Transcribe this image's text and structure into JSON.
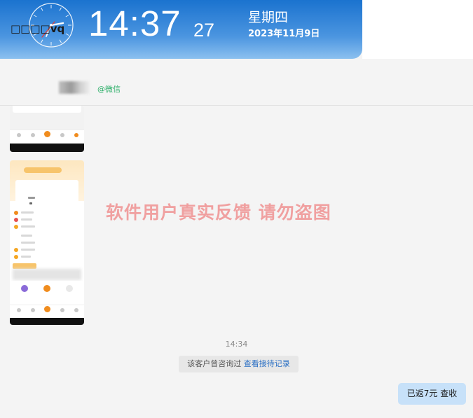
{
  "clock": {
    "time_main": "14:37",
    "time_seconds": "27",
    "weekday": "星期四",
    "date": "2023年11月9日"
  },
  "chat": {
    "contact_name": "□□□□vq",
    "channel": "@微信",
    "message_time": "14:34",
    "consult_text": "该客户曾咨询过",
    "consult_link": "查看接待记录",
    "outgoing_message": "已返7元  查收"
  },
  "watermark": "软件用户真实反馈  请勿盗图",
  "colors": {
    "clock_gradient_top": "#1b73cf",
    "clock_gradient_bottom": "#8cc0ef",
    "wechat_green": "#2aae67",
    "link_blue": "#2a6fc4",
    "bubble_blue": "#c7e1f9",
    "watermark_pink": "#f0a0a0"
  }
}
